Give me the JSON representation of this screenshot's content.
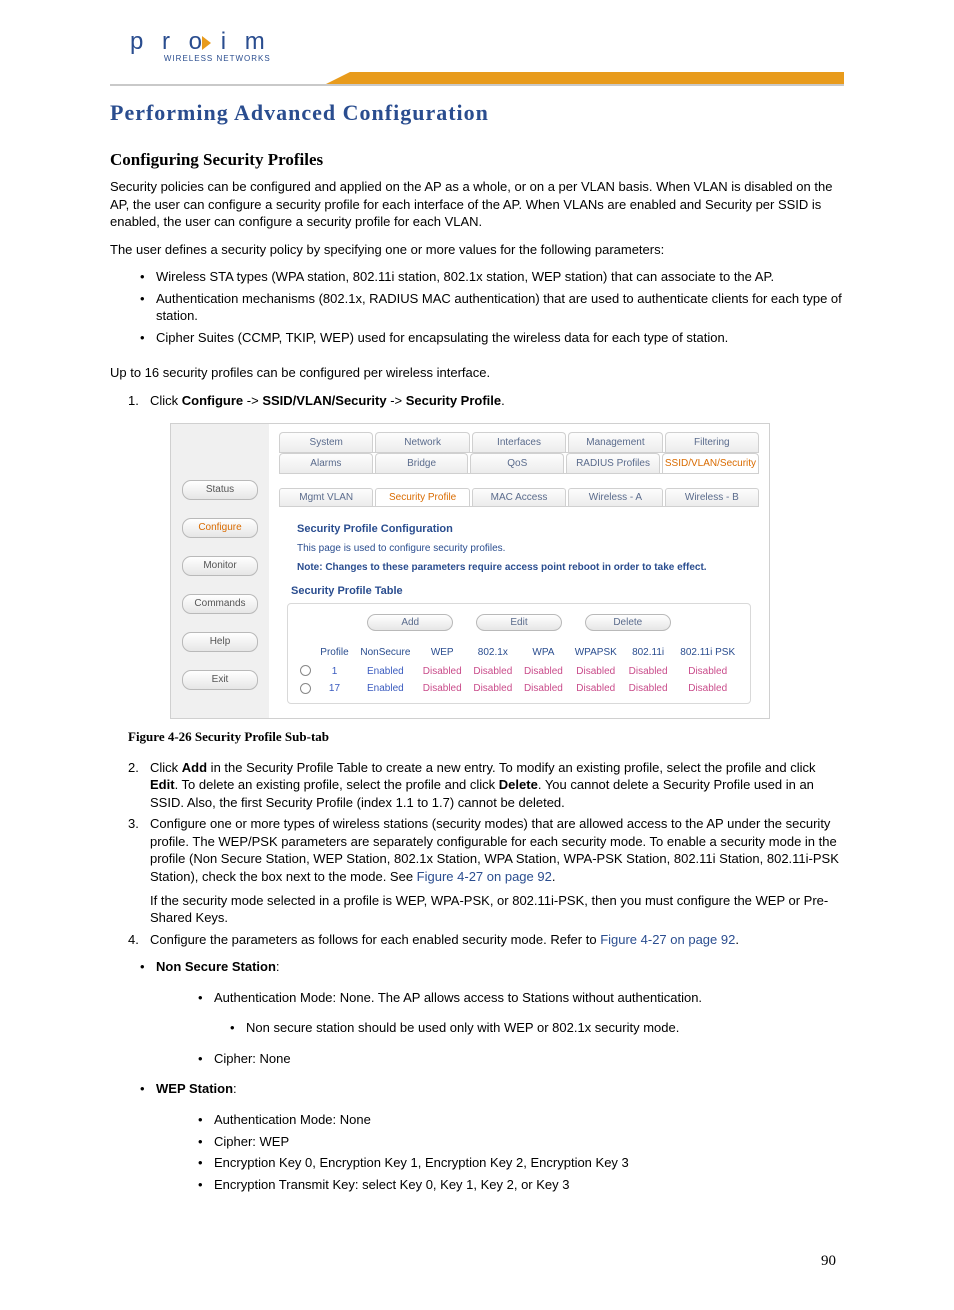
{
  "brand": {
    "name": "proxim",
    "sub": "WIRELESS NETWORKS"
  },
  "chapter_title": "Performing Advanced Configuration",
  "section_title": "Configuring Security Profiles",
  "p1": "Security policies can be configured and applied on the AP as a whole, or on a per VLAN basis. When VLAN is disabled on the AP, the user can configure a security profile for each interface of the AP. When VLANs are enabled and Security per SSID is enabled, the user can configure a security profile for each VLAN.",
  "p2": "The user defines a security policy by specifying one or more values for the following parameters:",
  "bullets1": [
    "Wireless STA types (WPA station, 802.11i station, 802.1x station, WEP station) that can associate to the AP.",
    "Authentication mechanisms (802.1x, RADIUS MAC authentication) that are used to authenticate clients for each type of station.",
    "Cipher Suites (CCMP, TKIP, WEP) used for encapsulating the wireless data for each type of station."
  ],
  "p3": "Up to 16 security profiles can be configured per wireless interface.",
  "step1": {
    "pre": "Click ",
    "b1": "Configure",
    "mid1": " -> ",
    "b2": "SSID/VLAN/Security",
    "mid2": " -> ",
    "b3": "Security Profile",
    "post": "."
  },
  "app": {
    "side": [
      "Status",
      "Configure",
      "Monitor",
      "Commands",
      "Help",
      "Exit"
    ],
    "side_active_index": 1,
    "tabs_row1": [
      "System",
      "Network",
      "Interfaces",
      "Management",
      "Filtering"
    ],
    "tabs_row2": [
      "Alarms",
      "Bridge",
      "QoS",
      "RADIUS Profiles",
      "SSID/VLAN/Security"
    ],
    "tabs_row2_active_index": 4,
    "subtabs": [
      "Mgmt VLAN",
      "Security Profile",
      "MAC Access",
      "Wireless - A",
      "Wireless - B"
    ],
    "subtabs_active_index": 1,
    "panel_title": "Security Profile Configuration",
    "panel_sub": "This page is used to configure security profiles.",
    "panel_note": "Note: Changes to these parameters require access point reboot in order to take effect.",
    "table_title": "Security Profile Table",
    "buttons": [
      "Add",
      "Edit",
      "Delete"
    ],
    "columns": [
      "",
      "Profile",
      "NonSecure",
      "WEP",
      "802.1x",
      "WPA",
      "WPAPSK",
      "802.11i",
      "802.11i PSK"
    ],
    "rows": [
      {
        "profile": "1",
        "nonsecure": "Enabled",
        "wep": "Disabled",
        "x8021": "Disabled",
        "wpa": "Disabled",
        "wpapsk": "Disabled",
        "i80211": "Disabled",
        "ipsk": "Disabled"
      },
      {
        "profile": "17",
        "nonsecure": "Enabled",
        "wep": "Disabled",
        "x8021": "Disabled",
        "wpa": "Disabled",
        "wpapsk": "Disabled",
        "i80211": "Disabled",
        "ipsk": "Disabled"
      }
    ]
  },
  "figure_caption": "Figure 4-26    Security Profile Sub-tab",
  "step2": {
    "pre": "Click ",
    "b1": "Add",
    "mid1": " in the Security Profile Table to create a new entry. To modify an existing profile, select the profile and click ",
    "b2": "Edit",
    "mid2": ". To delete an existing profile, select the profile and click ",
    "b3": "Delete",
    "post": ". You cannot delete a Security Profile used in an SSID. Also, the first Security Profile (index 1.1 to 1.7) cannot be deleted."
  },
  "step3a": "Configure one or more types of wireless stations (security modes) that are allowed access to the AP under the security profile. The WEP/PSK parameters are separately configurable for each security mode. To enable a security mode in the profile (Non Secure Station, WEP Station, 802.1x Station, WPA Station, WPA-PSK Station, 802.11i Station, 802.11i-PSK Station), check the box next to the mode. See ",
  "link1": "Figure 4-27 on page 92",
  "step3a_end": ".",
  "step3b": "If the security mode selected in a profile is WEP, WPA-PSK, or 802.11i-PSK, then you must configure the WEP or Pre-Shared Keys.",
  "step4_pre": "Configure the parameters as follows for each enabled security mode. Refer to ",
  "step4_end": ".",
  "nss_title": "Non Secure Station",
  "nss_items": [
    "Authentication Mode: None. The AP allows access to Stations without authentication.",
    "Cipher: None"
  ],
  "nss_sub": "Non secure station should be used only with WEP or 802.1x security mode.",
  "wep_title": "WEP Station",
  "wep_items": [
    "Authentication Mode: None",
    "Cipher: WEP",
    "Encryption Key 0, Encryption Key 1, Encryption Key 2, Encryption Key 3",
    "Encryption Transmit Key: select Key 0, Key 1, Key 2, or Key 3"
  ],
  "page_number": "90"
}
